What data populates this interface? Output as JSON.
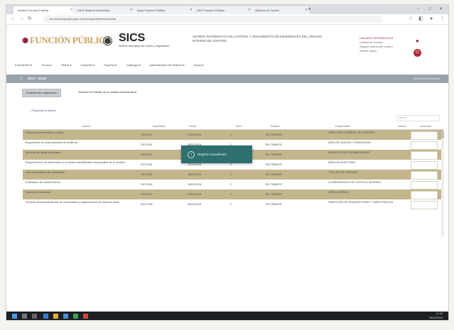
{
  "browser": {
    "tabs": [
      {
        "label": "Intranet Función Pública"
      },
      {
        "label": "SICS Sistema Informático"
      },
      {
        "label": "Inicio Función Pública"
      },
      {
        "label": "SICS Función Pública"
      },
      {
        "label": "Sistema de Control"
      }
    ],
    "url": "sics.funcionpublica.gob.mx/sics/expedientes/consulta",
    "new_tab_symbol": "+",
    "window_controls": [
      "–",
      "□",
      "✕"
    ]
  },
  "header": {
    "brand_name": "FUNCIÓN PÚBLICA",
    "sics_title": "SICS",
    "sics_subtitle": "Sistema Informático de Control y Seguimiento",
    "description": "SISTEMA INFORMÁTICO DE CONTROL Y SEGUIMIENTO DE EXPEDIENTES DEL ÓRGANO INTERNO DE CONTROL",
    "user": {
      "name": "USUARIO SISTEMA SICS",
      "line2": "Unidad de Control",
      "line3": "Órgano Interno de Control",
      "line4": "Sesión activa"
    }
  },
  "menu": {
    "items": [
      "Expedientes ▾",
      "Turnos ▾",
      "Oficios ▾",
      "Consultas ▾",
      "Reportes ▾",
      "Catálogos ▾",
      "Administración del Sistema ▾",
      "Ayuda ▾"
    ]
  },
  "titlebar": {
    "title": "SICS · Inicio",
    "right": "Bienvenido al sistema"
  },
  "subtabs": [
    "Expedientes registrados",
    "Asuntos en trámite de la unidad administrativa"
  ],
  "back_link": "« Regresar al listado",
  "filter_placeholder": "Buscar...",
  "table": {
    "columns": [
      "Asunto",
      "Expediente",
      "Fecha",
      "Turno",
      "Estatus",
      "Responsable",
      "Avance",
      "Acciones"
    ],
    "rows": [
      {
        "asunto": "Solicitud de información pública",
        "exp": "SICS-001",
        "fecha": "01/02/2018",
        "turno": "1",
        "estatus": "EN TRÁMITE",
        "resp": "DIRECCIÓN GENERAL DE CONTROL"
      },
      {
        "asunto": "Seguimiento de observaciones de auditoría",
        "exp": "SICS-002",
        "fecha": "05/02/2018",
        "turno": "2",
        "estatus": "EN TRÁMITE",
        "resp": "ÁREA DE QUEJAS Y DENUNCIAS"
      },
      {
        "asunto": "Atención de queja ciudadana",
        "exp": "SICS-003",
        "fecha": "09/02/2018",
        "turno": "1",
        "estatus": "EN TRÁMITE",
        "resp": "ÁREA DE RESPONSABILIDADES"
      },
      {
        "asunto": "Requerimiento de información a la unidad administrativa responsable de la revisión",
        "exp": "SICS-004",
        "fecha": "12/02/2018",
        "turno": "3",
        "estatus": "EN TRÁMITE",
        "resp": "ÁREA DE AUDITORÍA"
      },
      {
        "asunto": "Informe trimestral de actividades",
        "exp": "SICS-005",
        "fecha": "15/02/2018",
        "turno": "1",
        "estatus": "EN TRÁMITE",
        "resp": "TITULAR DEL ÓRGANO"
      },
      {
        "asunto": "Evaluación de control interno",
        "exp": "SICS-006",
        "fecha": "19/02/2018",
        "turno": "2",
        "estatus": "EN TRÁMITE",
        "resp": "COORDINACIÓN DE CONTROL INTERNO"
      },
      {
        "asunto": "Solicitud de atención",
        "exp": "SICS-007",
        "fecha": "22/02/2018",
        "turno": "1",
        "estatus": "EN TRÁMITE",
        "resp": "ÁREA JURÍDICA"
      },
      {
        "asunto": "Revisión de procedimientos de contratación y adquisiciones del ejercicio fiscal",
        "exp": "SICS-008",
        "fecha": "26/02/2018",
        "turno": "2",
        "estatus": "EN TRÁMITE",
        "resp": "DIRECCIÓN DE ADQUISICIONES Y OBRA PÚBLICA"
      }
    ]
  },
  "toast": {
    "icon": "info-icon",
    "message": "Registro actualizado"
  },
  "taskbar": {
    "time": "11:42",
    "date": "28/02/2018"
  },
  "colors": {
    "row_band": "#c3b58c",
    "titlebar": "#9aa3ad",
    "toast": "#2e6f6f",
    "brand_gold": "#c9a560",
    "brand_wine": "#8f2240"
  }
}
